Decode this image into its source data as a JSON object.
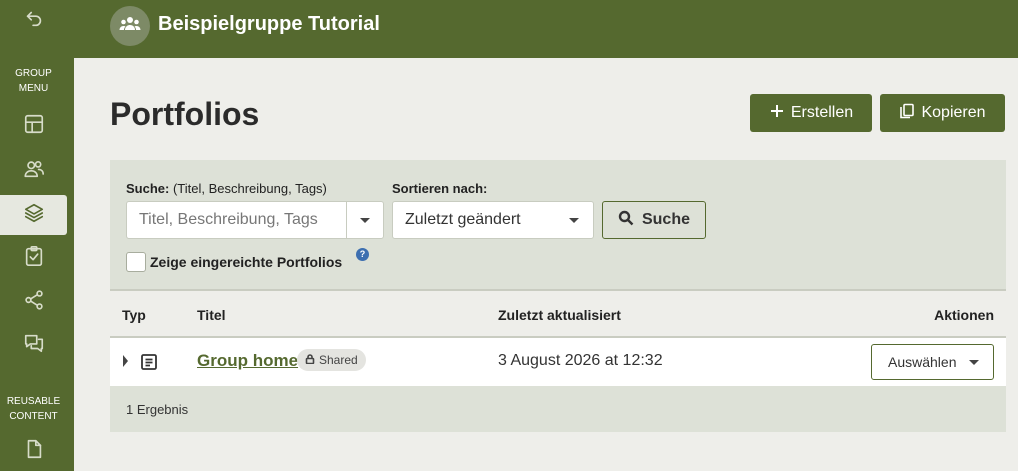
{
  "sidebar": {
    "group_menu_label": "GROUP MENU",
    "reusable_content_label": "REUSABLE CONTENT"
  },
  "header": {
    "group_title": "Beispielgruppe Tutorial"
  },
  "page": {
    "title": "Portfolios",
    "create_label": "Erstellen",
    "copy_label": "Kopieren"
  },
  "filter": {
    "search_label": "Suche:",
    "search_hint": "(Titel, Beschreibung, Tags)",
    "search_placeholder": "Titel, Beschreibung, Tags",
    "sort_label": "Sortieren nach:",
    "sort_value": "Zuletzt geändert",
    "search_button": "Suche",
    "show_submitted_label": "Zeige eingereichte Portfolios",
    "help_glyph": "?"
  },
  "table": {
    "headers": {
      "type": "Typ",
      "title": "Titel",
      "updated": "Zuletzt aktualisiert",
      "actions": "Aktionen"
    },
    "rows": [
      {
        "title": "Group home",
        "badge": "Shared",
        "updated": "3 August 2026 at 12:32",
        "action": "Auswählen"
      }
    ],
    "result_count": "1 Ergebnis"
  },
  "colors": {
    "brand": "#55692f",
    "panel": "#dde1d7",
    "help": "#3d6fb0"
  }
}
